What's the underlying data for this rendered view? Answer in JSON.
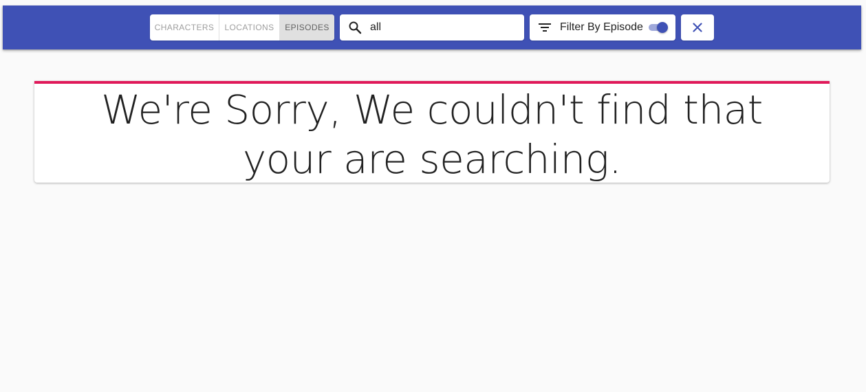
{
  "header": {
    "tabs": [
      {
        "label": "CHARACTERS",
        "active": false
      },
      {
        "label": "LOCATIONS",
        "active": false
      },
      {
        "label": "EPISODES",
        "active": true
      }
    ],
    "search": {
      "value": "all",
      "icon": "search-icon"
    },
    "filter": {
      "label": "Filter By Episode",
      "icon": "filter-list-icon",
      "toggle_on": true
    },
    "close": {
      "icon": "close-icon"
    },
    "colors": {
      "appbar": "#3f51b5",
      "accent": "#e0195a"
    }
  },
  "main": {
    "message": "We're Sorry, We couldn't find that your are searching."
  }
}
